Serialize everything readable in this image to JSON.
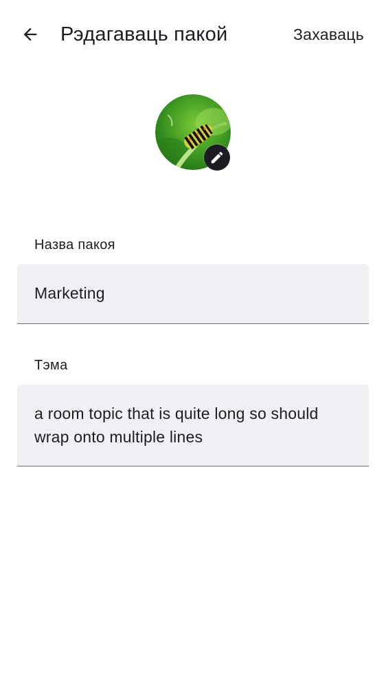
{
  "header": {
    "back_icon": "arrow-left-icon",
    "title": "Рэдагаваць пакой",
    "save_label": "Захаваць"
  },
  "avatar": {
    "image": "caterpillar-on-green-leaf",
    "edit_icon": "pencil-icon"
  },
  "form": {
    "name": {
      "label": "Назва пакоя",
      "value": "Marketing"
    },
    "topic": {
      "label": "Тэма",
      "value": "a room topic that is quite long so should wrap onto multiple lines"
    }
  },
  "colors": {
    "text": "#1b1d22",
    "field_bg": "#eff0f4",
    "field_underline": "#6b6f78",
    "badge_bg": "#1b1d22"
  }
}
